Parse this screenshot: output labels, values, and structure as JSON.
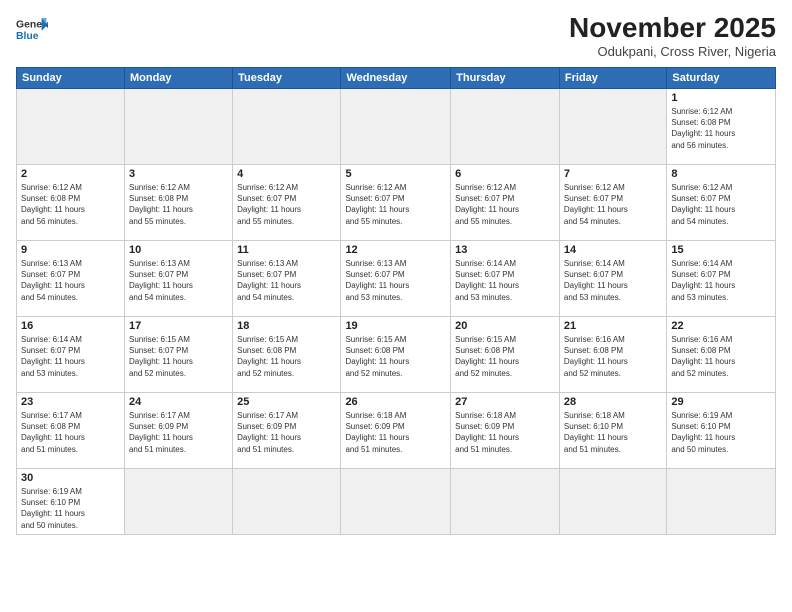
{
  "header": {
    "logo_general": "General",
    "logo_blue": "Blue",
    "month_title": "November 2025",
    "location": "Odukpani, Cross River, Nigeria"
  },
  "days_of_week": [
    "Sunday",
    "Monday",
    "Tuesday",
    "Wednesday",
    "Thursday",
    "Friday",
    "Saturday"
  ],
  "weeks": [
    [
      {
        "day": "",
        "info": ""
      },
      {
        "day": "",
        "info": ""
      },
      {
        "day": "",
        "info": ""
      },
      {
        "day": "",
        "info": ""
      },
      {
        "day": "",
        "info": ""
      },
      {
        "day": "",
        "info": ""
      },
      {
        "day": "1",
        "info": "Sunrise: 6:12 AM\nSunset: 6:08 PM\nDaylight: 11 hours\nand 56 minutes."
      }
    ],
    [
      {
        "day": "2",
        "info": "Sunrise: 6:12 AM\nSunset: 6:08 PM\nDaylight: 11 hours\nand 56 minutes."
      },
      {
        "day": "3",
        "info": "Sunrise: 6:12 AM\nSunset: 6:08 PM\nDaylight: 11 hours\nand 55 minutes."
      },
      {
        "day": "4",
        "info": "Sunrise: 6:12 AM\nSunset: 6:07 PM\nDaylight: 11 hours\nand 55 minutes."
      },
      {
        "day": "5",
        "info": "Sunrise: 6:12 AM\nSunset: 6:07 PM\nDaylight: 11 hours\nand 55 minutes."
      },
      {
        "day": "6",
        "info": "Sunrise: 6:12 AM\nSunset: 6:07 PM\nDaylight: 11 hours\nand 55 minutes."
      },
      {
        "day": "7",
        "info": "Sunrise: 6:12 AM\nSunset: 6:07 PM\nDaylight: 11 hours\nand 54 minutes."
      },
      {
        "day": "8",
        "info": "Sunrise: 6:12 AM\nSunset: 6:07 PM\nDaylight: 11 hours\nand 54 minutes."
      }
    ],
    [
      {
        "day": "9",
        "info": "Sunrise: 6:13 AM\nSunset: 6:07 PM\nDaylight: 11 hours\nand 54 minutes."
      },
      {
        "day": "10",
        "info": "Sunrise: 6:13 AM\nSunset: 6:07 PM\nDaylight: 11 hours\nand 54 minutes."
      },
      {
        "day": "11",
        "info": "Sunrise: 6:13 AM\nSunset: 6:07 PM\nDaylight: 11 hours\nand 54 minutes."
      },
      {
        "day": "12",
        "info": "Sunrise: 6:13 AM\nSunset: 6:07 PM\nDaylight: 11 hours\nand 53 minutes."
      },
      {
        "day": "13",
        "info": "Sunrise: 6:14 AM\nSunset: 6:07 PM\nDaylight: 11 hours\nand 53 minutes."
      },
      {
        "day": "14",
        "info": "Sunrise: 6:14 AM\nSunset: 6:07 PM\nDaylight: 11 hours\nand 53 minutes."
      },
      {
        "day": "15",
        "info": "Sunrise: 6:14 AM\nSunset: 6:07 PM\nDaylight: 11 hours\nand 53 minutes."
      }
    ],
    [
      {
        "day": "16",
        "info": "Sunrise: 6:14 AM\nSunset: 6:07 PM\nDaylight: 11 hours\nand 53 minutes."
      },
      {
        "day": "17",
        "info": "Sunrise: 6:15 AM\nSunset: 6:07 PM\nDaylight: 11 hours\nand 52 minutes."
      },
      {
        "day": "18",
        "info": "Sunrise: 6:15 AM\nSunset: 6:08 PM\nDaylight: 11 hours\nand 52 minutes."
      },
      {
        "day": "19",
        "info": "Sunrise: 6:15 AM\nSunset: 6:08 PM\nDaylight: 11 hours\nand 52 minutes."
      },
      {
        "day": "20",
        "info": "Sunrise: 6:15 AM\nSunset: 6:08 PM\nDaylight: 11 hours\nand 52 minutes."
      },
      {
        "day": "21",
        "info": "Sunrise: 6:16 AM\nSunset: 6:08 PM\nDaylight: 11 hours\nand 52 minutes."
      },
      {
        "day": "22",
        "info": "Sunrise: 6:16 AM\nSunset: 6:08 PM\nDaylight: 11 hours\nand 52 minutes."
      }
    ],
    [
      {
        "day": "23",
        "info": "Sunrise: 6:17 AM\nSunset: 6:08 PM\nDaylight: 11 hours\nand 51 minutes."
      },
      {
        "day": "24",
        "info": "Sunrise: 6:17 AM\nSunset: 6:09 PM\nDaylight: 11 hours\nand 51 minutes."
      },
      {
        "day": "25",
        "info": "Sunrise: 6:17 AM\nSunset: 6:09 PM\nDaylight: 11 hours\nand 51 minutes."
      },
      {
        "day": "26",
        "info": "Sunrise: 6:18 AM\nSunset: 6:09 PM\nDaylight: 11 hours\nand 51 minutes."
      },
      {
        "day": "27",
        "info": "Sunrise: 6:18 AM\nSunset: 6:09 PM\nDaylight: 11 hours\nand 51 minutes."
      },
      {
        "day": "28",
        "info": "Sunrise: 6:18 AM\nSunset: 6:10 PM\nDaylight: 11 hours\nand 51 minutes."
      },
      {
        "day": "29",
        "info": "Sunrise: 6:19 AM\nSunset: 6:10 PM\nDaylight: 11 hours\nand 50 minutes."
      }
    ],
    [
      {
        "day": "30",
        "info": "Sunrise: 6:19 AM\nSunset: 6:10 PM\nDaylight: 11 hours\nand 50 minutes."
      },
      {
        "day": "",
        "info": ""
      },
      {
        "day": "",
        "info": ""
      },
      {
        "day": "",
        "info": ""
      },
      {
        "day": "",
        "info": ""
      },
      {
        "day": "",
        "info": ""
      },
      {
        "day": "",
        "info": ""
      }
    ]
  ]
}
